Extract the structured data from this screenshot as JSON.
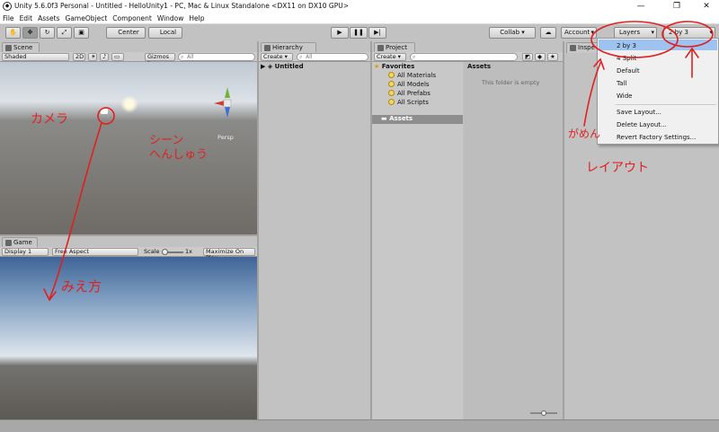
{
  "window": {
    "title": "Unity 5.6.0f3 Personal - Untitled - HelloUnity1 - PC, Mac & Linux Standalone <DX11 on DX10 GPU>",
    "minimize": "—",
    "maximize": "❐",
    "close": "✕"
  },
  "menu": [
    "File",
    "Edit",
    "Assets",
    "GameObject",
    "Component",
    "Window",
    "Help"
  ],
  "toolbar": {
    "pivot": "Center",
    "space": "Local",
    "collab": "Collab ▾",
    "account": "Account",
    "layers": "Layers",
    "layout": "2 by 3"
  },
  "scene": {
    "tab": "Scene",
    "shading": "Shaded",
    "mode_2d": "2D",
    "gizmos": "Gizmos ▾",
    "search_placeholder": "All",
    "persp": "Persp"
  },
  "game": {
    "tab": "Game",
    "display": "Display 1",
    "aspect": "Free Aspect",
    "scale_label": "Scale",
    "scale_value": "1x",
    "maximize": "Maximize On Play"
  },
  "hierarchy": {
    "tab": "Hierarchy",
    "create": "Create ▾",
    "search_placeholder": "All",
    "scene_name": "Untitled"
  },
  "project": {
    "tab": "Project",
    "create": "Create ▾",
    "favorites_label": "Favorites",
    "favorites": [
      "All Materials",
      "All Models",
      "All Prefabs",
      "All Scripts"
    ],
    "assets_folder": "Assets",
    "assets_header": "Assets",
    "empty_message": "This folder is empty"
  },
  "inspector": {
    "tab": "Inspe"
  },
  "layout_menu": {
    "items": [
      "2 by 3",
      "4 Split",
      "Default",
      "Tall",
      "Wide"
    ],
    "actions": [
      "Save Layout...",
      "Delete Layout...",
      "Revert Factory Settings..."
    ]
  },
  "annotations": {
    "camera": "カメラ",
    "scene_edit": "シーン\nへんしゅう",
    "view": "みえ方",
    "screen": "がめん",
    "layout": "レイアウト"
  }
}
